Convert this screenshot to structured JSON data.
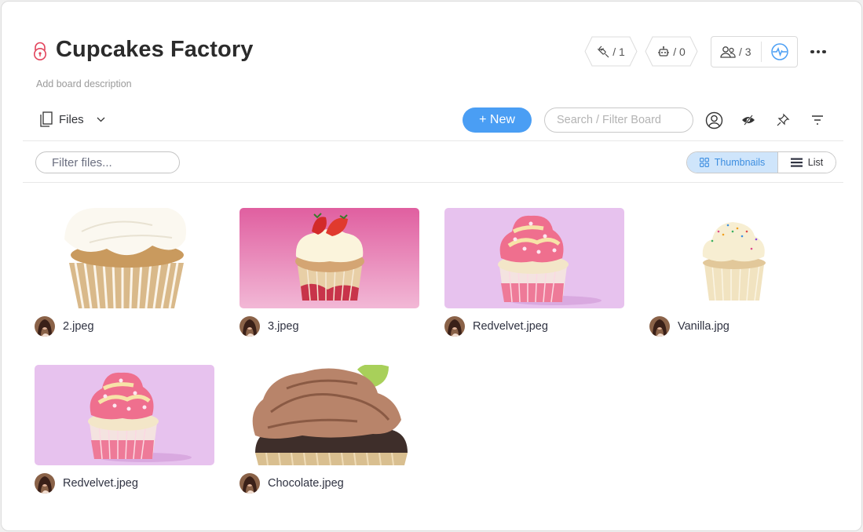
{
  "board": {
    "title": "Cupcakes Factory",
    "description_placeholder": "Add board description",
    "lock_icon": "lock-icon"
  },
  "header_actions": {
    "integrations": {
      "icon": "plug-icon",
      "label": "/ 1"
    },
    "automations": {
      "icon": "robot-icon",
      "label": "/ 0"
    },
    "members": {
      "icon": "people-icon",
      "label": "/ 3"
    },
    "activity": {
      "icon": "activity-pulse-icon",
      "color": "#4a9ef4"
    },
    "more": {
      "icon": "more-dots-icon"
    }
  },
  "toolbar": {
    "view_name": "Files",
    "view_icon": "files-icon",
    "new_label": "+ New",
    "search_placeholder": "Search / Filter Board",
    "icons": [
      "person-filter-icon",
      "hide-eye-icon",
      "pin-icon",
      "sort-filter-icon"
    ],
    "accent": "#4a9ef4"
  },
  "files_bar": {
    "filter_placeholder": "Filter files...",
    "view_toggle": [
      {
        "label": "Thumbnails",
        "icon": "grid-icon",
        "active": true
      },
      {
        "label": "List",
        "icon": "list-icon",
        "active": false
      }
    ]
  },
  "files": [
    {
      "name": "2.jpeg",
      "image": "vanilla-frosting-cupcake"
    },
    {
      "name": "3.jpeg",
      "image": "strawberry-cupcake-pink-bg"
    },
    {
      "name": "Redvelvet.jpeg",
      "image": "pink-swirl-cupcake-lilac-bg"
    },
    {
      "name": "Vanilla.jpg",
      "image": "sprinkles-vanilla-cupcake"
    },
    {
      "name": "Redvelvet.jpeg",
      "image": "pink-swirl-cupcake-lilac-bg"
    },
    {
      "name": "Chocolate.jpeg",
      "image": "chocolate-frosting-cupcake"
    }
  ]
}
